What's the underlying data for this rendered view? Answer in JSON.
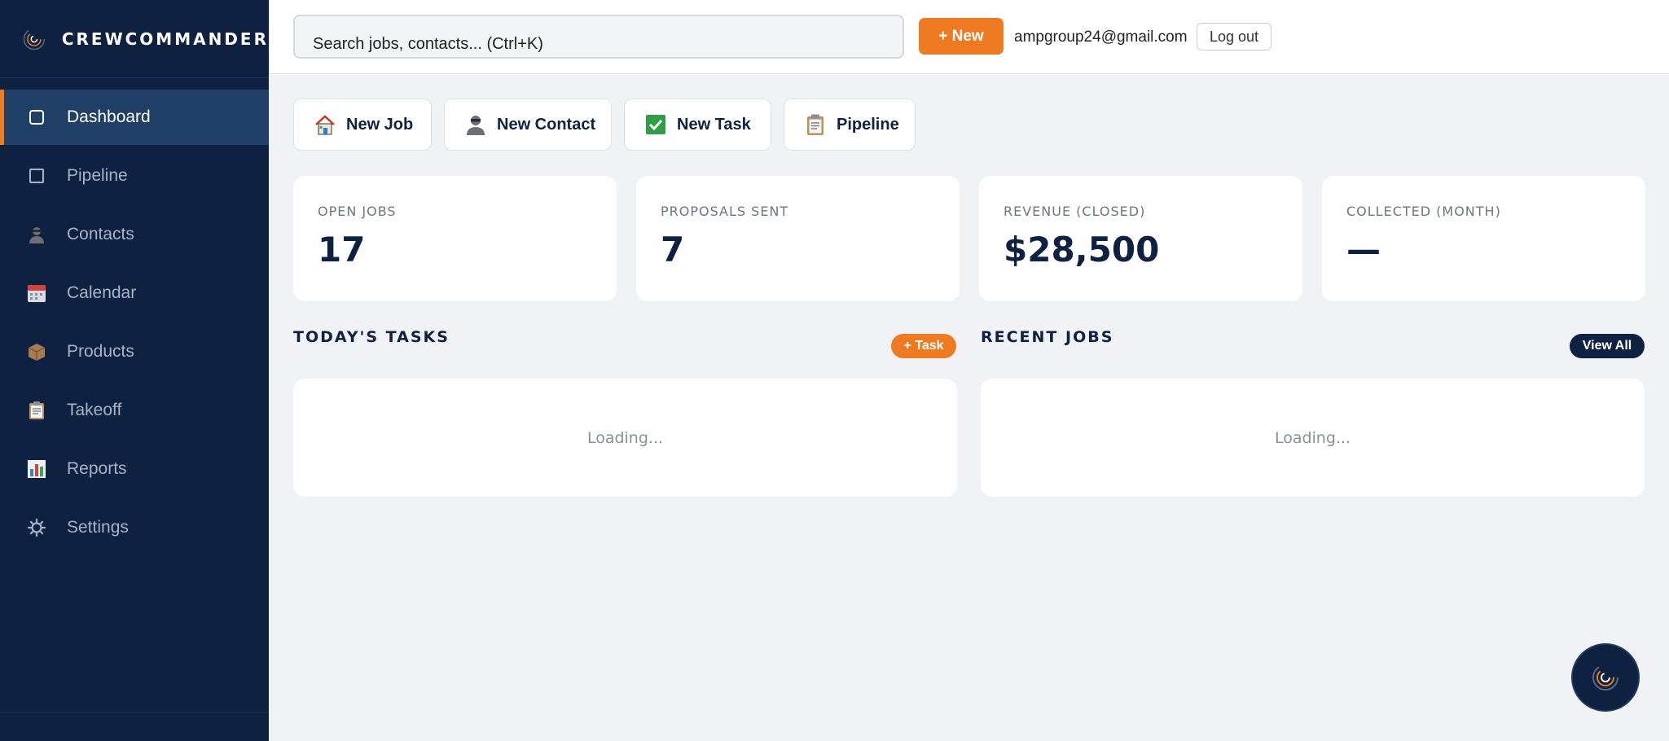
{
  "brand": {
    "name": "CREWCOMMANDER",
    "accent": "#f07a22",
    "navy": "#0e2140"
  },
  "sidebar": {
    "items": [
      {
        "label": "Dashboard",
        "icon": "square-outline-icon",
        "active": true
      },
      {
        "label": "Pipeline",
        "icon": "square-outline-icon"
      },
      {
        "label": "Contacts",
        "icon": "person-icon"
      },
      {
        "label": "Calendar",
        "icon": "calendar-icon"
      },
      {
        "label": "Products",
        "icon": "package-icon"
      },
      {
        "label": "Takeoff",
        "icon": "clipboard-icon"
      },
      {
        "label": "Reports",
        "icon": "bar-chart-icon"
      },
      {
        "label": "Settings",
        "icon": "gear-icon"
      }
    ]
  },
  "topbar": {
    "search_placeholder": "Search jobs, contacts... (Ctrl+K)",
    "new_label": "+ New",
    "user_email": "ampgroup24@gmail.com",
    "logout_label": "Log out"
  },
  "quick_actions": [
    {
      "label": "New Job",
      "icon": "house-icon"
    },
    {
      "label": "New Contact",
      "icon": "person-icon"
    },
    {
      "label": "New Task",
      "icon": "checkbox-icon"
    },
    {
      "label": "Pipeline",
      "icon": "clipboard-icon"
    }
  ],
  "stats": [
    {
      "label": "OPEN JOBS",
      "value": "17"
    },
    {
      "label": "PROPOSALS SENT",
      "value": "7"
    },
    {
      "label": "REVENUE (CLOSED)",
      "value": "$28,500"
    },
    {
      "label": "COLLECTED (MONTH)",
      "value": "—"
    }
  ],
  "tasks": {
    "title": "TODAY'S TASKS",
    "button_label": "+ Task",
    "loading_text": "Loading..."
  },
  "recent_jobs": {
    "title": "RECENT JOBS",
    "button_label": "View All",
    "loading_text": "Loading..."
  }
}
